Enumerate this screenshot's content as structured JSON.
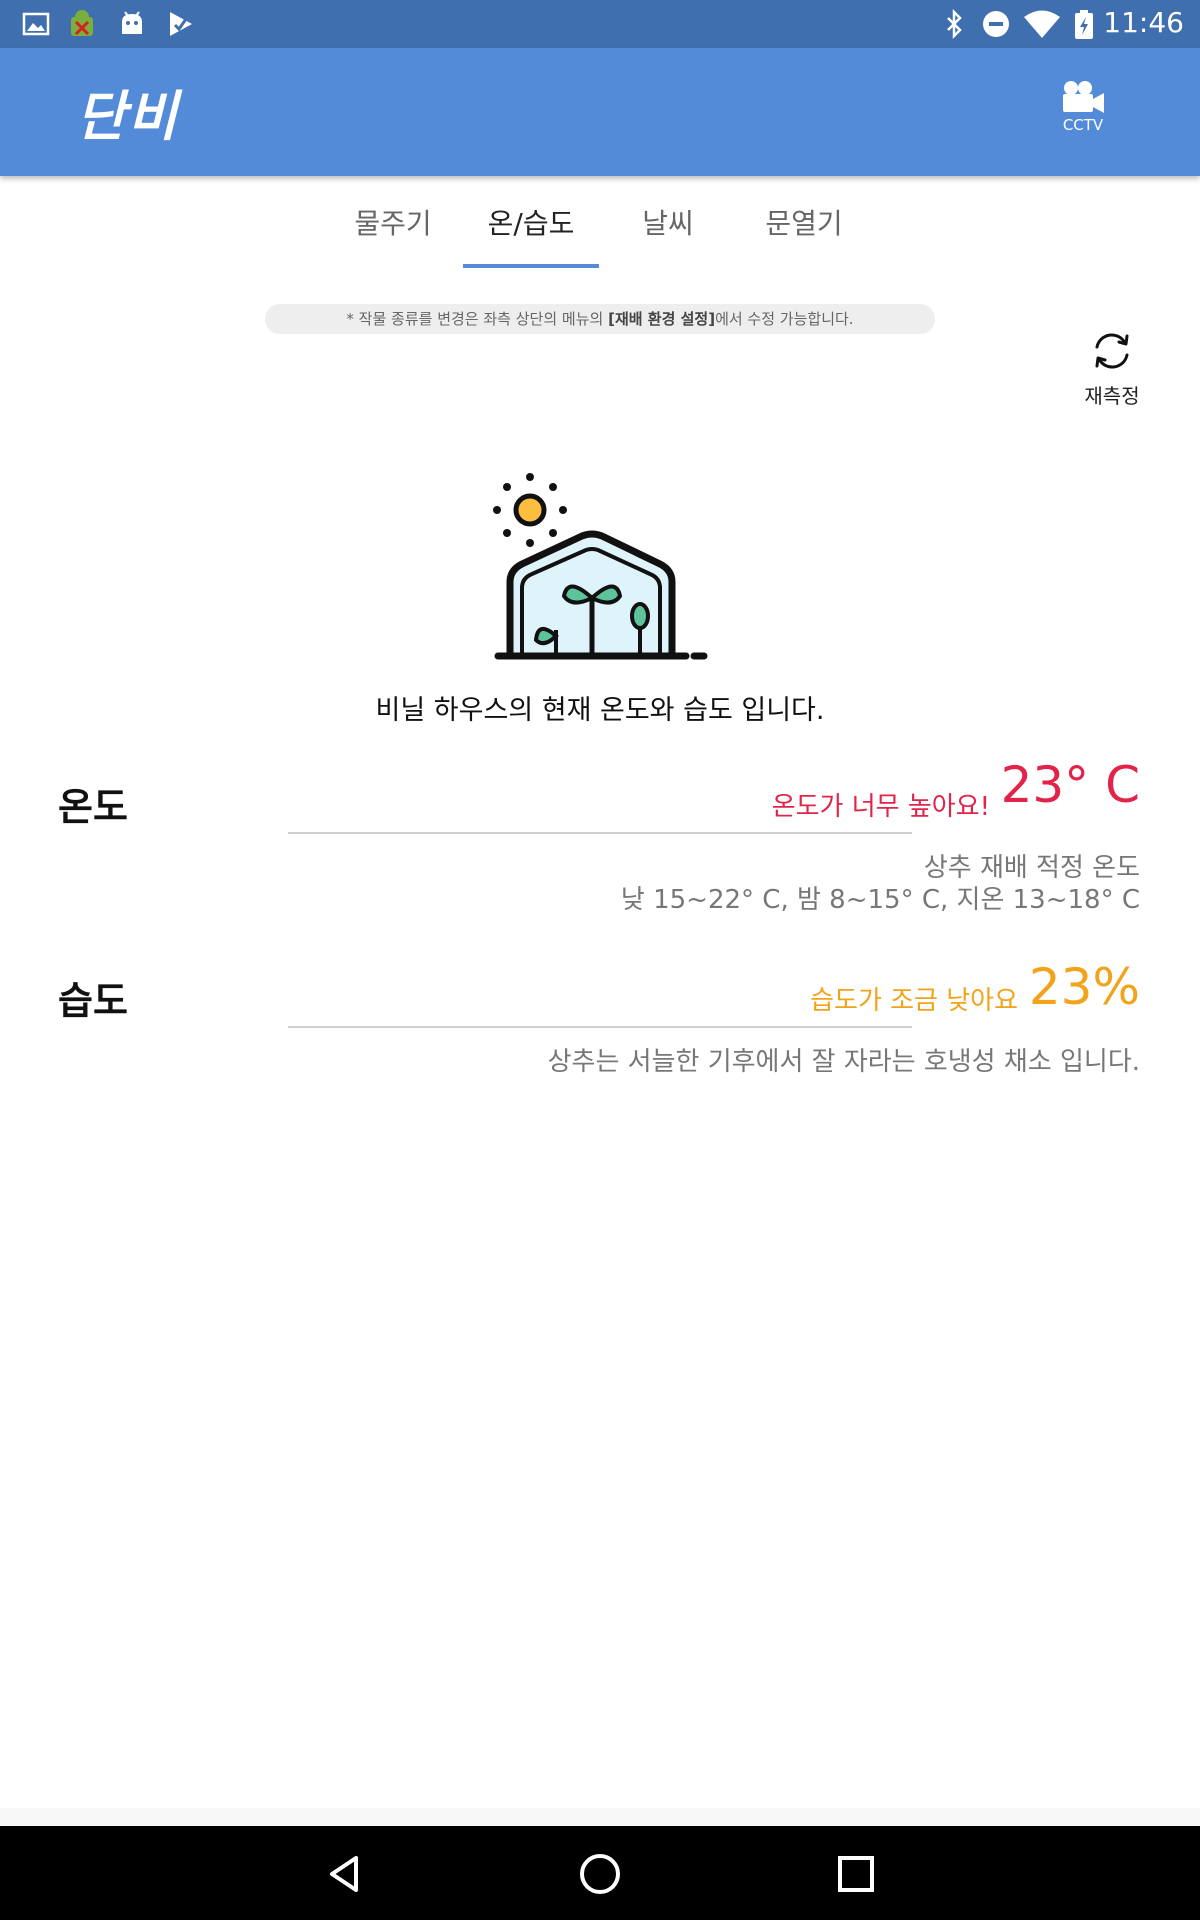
{
  "status_bar": {
    "time": "11:46",
    "left_icons": [
      "image-icon",
      "android-debug-icon",
      "android-robot-icon",
      "play-store-icon"
    ],
    "right_icons": [
      "bluetooth-icon",
      "do-not-disturb-icon",
      "wifi-icon",
      "battery-charging-icon"
    ]
  },
  "app_bar": {
    "title": "단비",
    "cctv_label": "CCTV",
    "background": "#538bd8"
  },
  "tabs": [
    {
      "label": "물주기",
      "active": false
    },
    {
      "label": "온/습도",
      "active": true
    },
    {
      "label": "날씨",
      "active": false
    },
    {
      "label": "문열기",
      "active": false
    }
  ],
  "notice": {
    "prefix": "* 작물 종류를 변경은 좌측 상단의 메뉴의 ",
    "emphasis": "[재배 환경 설정]",
    "suffix": "에서 수정 가능합니다."
  },
  "remeasure": {
    "label": "재측정"
  },
  "subtitle": "비닐 하우스의 현재 온도와 습도 입니다.",
  "temperature": {
    "label": "온도",
    "status": "온도가 너무 높아요!",
    "value": "23° C",
    "info_title": "상추 재배 적정 온도",
    "info_range": "낮 15~22° C, 밤 8~15° C, 지온 13~18° C",
    "color": "#e2234a"
  },
  "humidity": {
    "label": "습도",
    "status": "습도가 조금 낮아요",
    "value": "23%",
    "info": "상추는 서늘한 기후에서 잘 자라는 호냉성 채소 입니다.",
    "color": "#f2a31c"
  },
  "nav_bar": {
    "icons": [
      "back-icon",
      "home-icon",
      "recents-icon"
    ]
  }
}
